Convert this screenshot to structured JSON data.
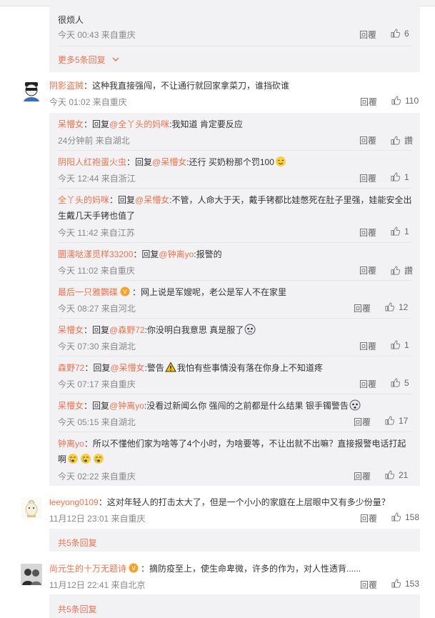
{
  "colors": {
    "accent": "#eb7350",
    "sub_bg": "#f2f2f5",
    "meta": "#888888"
  },
  "reply_label": "回覆",
  "block1": {
    "tail_text": "很烦人",
    "tail_meta": "今天 00:43 来自重庆",
    "tail_likes": "6",
    "more": "更多5条回复"
  },
  "comment1": {
    "name": "阴影盗贼",
    "text": "：这种我直接强闯，不让通行就回家拿菜刀，谁挡砍谁",
    "meta": "今天 01:02 来自重庆",
    "likes": "110"
  },
  "replies": [
    {
      "name": "呆懵女",
      "mid": "：回复",
      "at": "@全丫头的妈咪",
      "text": ":我知道 肯定要反应",
      "meta": "24分钟前 来自湖北",
      "likes": "讚"
    },
    {
      "name": "阴阳人红袍蛋火虫",
      "mid": "：回复",
      "at": "@呆懵女",
      "text": ":还行 买奶粉那个罚100",
      "meta": "今天 12:44 来自浙江",
      "likes": "1"
    },
    {
      "name": "全丫头的妈咪",
      "mid": "：回复",
      "at": "@呆懵女",
      "text": ":不管，人命大于天，戴手铐都比娃憋死在肚子里强，娃能安全出",
      "text2": "生戴几天手铐也值了",
      "meta": "今天 11:42 来自江苏",
      "likes": "1"
    },
    {
      "name": "圜濡哒漾觅样33200",
      "mid": "：回复",
      "at": "@钟离yo",
      "text": ":报警的",
      "meta": "今天 11:02 来自重庆",
      "likes": "讚"
    },
    {
      "name": "最后一只雅鸚碟",
      "mid": "",
      "at": "",
      "text": "：网上说是军嫂呢，老公是军人不在家里",
      "meta": "今天 08:27 来自河北",
      "likes": "12"
    },
    {
      "name": "呆懵女",
      "mid": "：回复",
      "at": "@森野72",
      "text": ":你没明白我意思 真是服了",
      "meta": "今天 07:30 来自湖北",
      "likes": "1"
    },
    {
      "name": "森野72",
      "mid": "：回复",
      "at": "@呆懵女",
      "text": ":警告",
      "text_after": "我怕有些事情没有落在你身上不知道疼",
      "meta": "今天 07:17 来自重庆",
      "likes": "5"
    },
    {
      "name": "呆懵女",
      "mid": "：回复",
      "at": "@钟离yo",
      "text": ":没看过新闻么你 强闯的之前都是什么结果 银手镯警告",
      "meta": "今天 05:15 来自湖北",
      "likes": "17"
    },
    {
      "name": "钟离yo",
      "mid": "",
      "at": "",
      "text": "：所以不懂他们家为啥等了4个小时，为啥要等，不让出就不出嘛？直接报警电话打起",
      "text2": "啊",
      "meta": "今天 02:22 来自重庆",
      "likes": "21"
    }
  ],
  "comment2": {
    "name": "leeyong0109",
    "text": "：这对年轻人的打击太大了，但是一个小小的家庭在上层眼中又有多少份量？",
    "meta": "11月12日 23:01 来自重庆",
    "likes": "158",
    "more": "共5条回复"
  },
  "comment3": {
    "name": "尚元生的十万无题诗",
    "text": "：摘防疫至上，使生命卑微，许多的作为，对人性透背......",
    "meta": "11月12日 22:41 来自北京",
    "likes": "153",
    "more": "共5条回复"
  }
}
